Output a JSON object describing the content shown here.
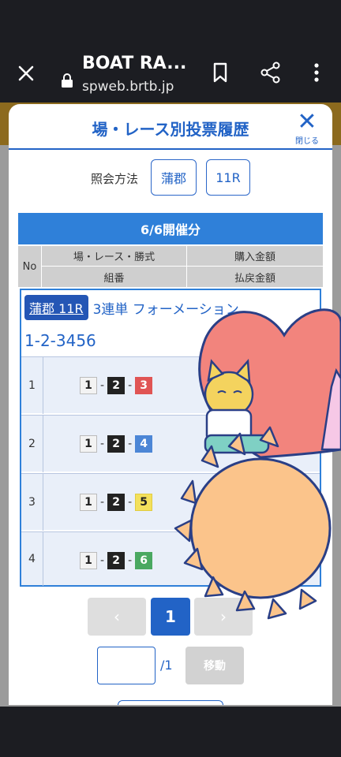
{
  "browser": {
    "page_title": "BOAT RA...",
    "url_host": "spweb.brtb.jp"
  },
  "modal": {
    "title": "場・レース別投票履歴",
    "close_label": "閉じる",
    "query_label": "照会方法",
    "venue_chip": "蒲郡",
    "race_chip": "11R",
    "date_header": "6/6開催分",
    "columns": {
      "no": "No",
      "race": "場・レース・勝式",
      "purchase": "購入金額",
      "combo": "組番",
      "refund": "払戻金額"
    },
    "ticket": {
      "venue_race": "蒲郡 11R",
      "bet_type": "3連単 フォーメーション",
      "combination": "1-2-3456",
      "rows": [
        {
          "no": "1",
          "first": "1",
          "second": "2",
          "third": "3"
        },
        {
          "no": "2",
          "first": "1",
          "second": "2",
          "third": "4"
        },
        {
          "no": "3",
          "first": "1",
          "second": "2",
          "third": "5"
        },
        {
          "no": "4",
          "first": "1",
          "second": "2",
          "third": "6"
        }
      ]
    },
    "pagination": {
      "prev": "‹",
      "current": "1",
      "next": "›",
      "total": "/1",
      "move": "移動"
    }
  },
  "colors": {
    "accent": "#2263c6",
    "boat1": "#f3f3f3",
    "boat2": "#222222",
    "boat3": "#e05454",
    "boat4": "#4c86d6",
    "boat5": "#f3e05c",
    "boat6": "#4aa861"
  }
}
